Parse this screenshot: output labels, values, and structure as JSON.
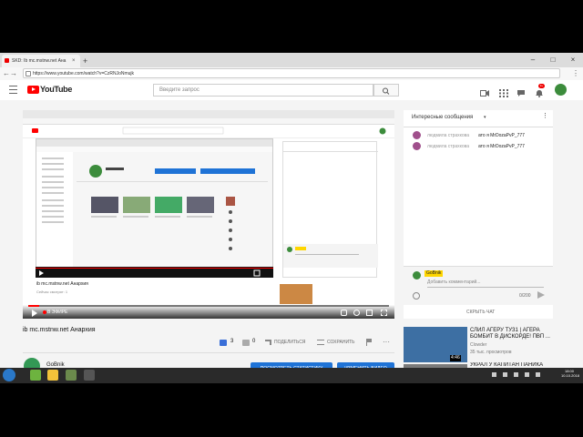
{
  "browser": {
    "tab_title": "SKD: Ib mc.mstnw.net Ана",
    "tab_close": "×",
    "new_tab": "+",
    "url": "https://www.youtube.com/watch?v=CzRNJoNmujk",
    "nav": {
      "back": "←",
      "forward": "→",
      "reload": "C"
    },
    "window": {
      "minimize": "–",
      "maximize": "□",
      "close": "×"
    },
    "menu": "⋮"
  },
  "youtube": {
    "logo_text": "YouTube",
    "logo_region": "RU",
    "search_placeholder": "Введите запрос",
    "notifications_count": "9+"
  },
  "nested": {
    "title": "ib mc.mstnw.net Анархия",
    "views": "Сейчас смотрят: 1"
  },
  "player": {
    "live_label": "В ЭФИРЕ"
  },
  "video": {
    "title": "ib mc.mstnw.net Анархия",
    "likes": "3",
    "dislikes": "0",
    "share_label": "ПОДЕЛИТЬСЯ",
    "save_label": "СОХРАНИТЬ",
    "more": "···"
  },
  "channel": {
    "name": "GoBnik",
    "stats_button": "ПОСМОТРЕТЬ СТАТИСТИКУ",
    "edit_button": "ИЗМЕНИТЬ ВИДЕО"
  },
  "chat": {
    "title": "Интересные сообщения",
    "dropdown": "▾",
    "menu": "⋮",
    "messages": [
      {
        "author": "людмила страхкова",
        "text": "ато я MrDozaPvP_777",
        "color": "#a0508c"
      },
      {
        "author": "людмила страхкова",
        "text": "ато я MrDozaPvP_777",
        "color": "#a0508c"
      }
    ],
    "my_name": "GoBnik",
    "input_placeholder": "Добавить комментарий...",
    "counter": "0/200",
    "hide_label": "СКРЫТЬ ЧАТ"
  },
  "suggestions": [
    {
      "title": "СЛИЛ АГЕРУ ТУЗ1 | АГЕРА БОМБИТ В ДИСКОРДЕ! ПВП ...",
      "channel": "Clowder",
      "views": "35 тыс. просмотров",
      "duration": "4:46",
      "color": "#3d6fa3"
    },
    {
      "title": "УКРАЛ У КАПИТАН ПАНИКА",
      "channel": "",
      "views": "",
      "duration": "",
      "color": "#7a7a7a"
    }
  ],
  "taskbar": {
    "time": "18:00",
    "date": "10.10.2018",
    "colors": {
      "accent": "#1f73d6",
      "brand": "#ff0000"
    }
  }
}
